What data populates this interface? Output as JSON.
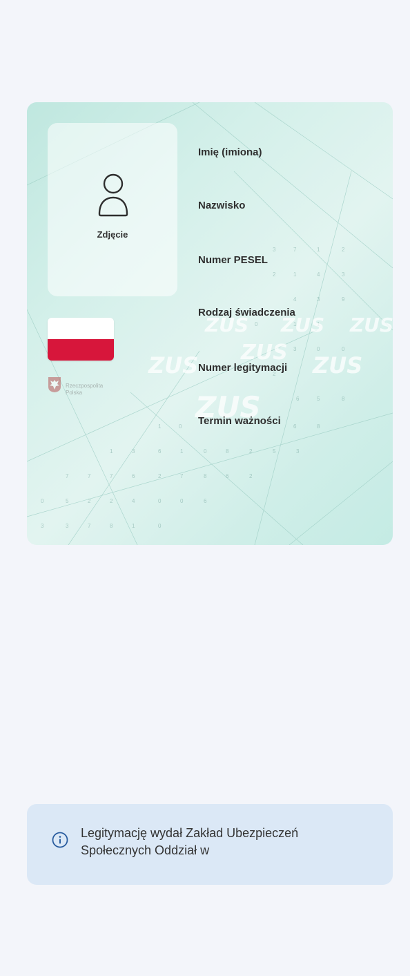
{
  "card": {
    "photo_label": "Zdjęcie",
    "fields": [
      "Imię (imiona)",
      "Nazwisko",
      "Numer PESEL",
      "Rodzaj świadczenia",
      "Numer legitymacji",
      "Termin ważności"
    ],
    "emblem_text_line1": "Rzeczpospolita",
    "emblem_text_line2": "Polska",
    "watermark": "ZUS",
    "flag_colors": {
      "top": "#ffffff",
      "bottom": "#d7163b"
    }
  },
  "info": {
    "icon": "info-icon",
    "text": "Legitymację wydał Zakład Ubezpieczeń Społecznych Oddział w"
  },
  "colors": {
    "background": "#f3f5fa",
    "card_tint": "#cfeee8",
    "info_background": "#dbe8f6",
    "info_icon": "#2a5d9f"
  }
}
